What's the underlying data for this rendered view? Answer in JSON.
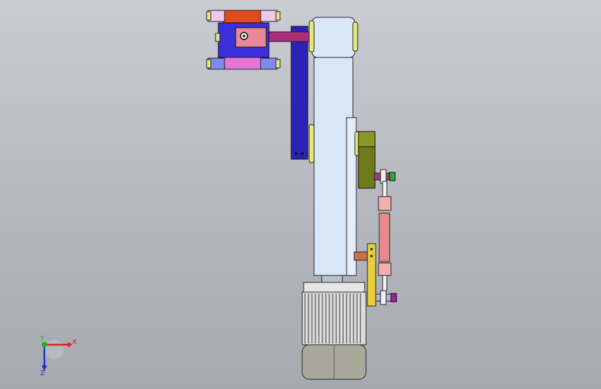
{
  "viewport": {
    "background": "#b8bcc2",
    "view": "front"
  },
  "model": {
    "description_parts": [
      "gearbox-housing",
      "drive-belt",
      "main-column",
      "motor",
      "linkage-rod",
      "bracket",
      "pivot-bolts"
    ],
    "colors": {
      "column": "#d8e6f8",
      "gearbox": "#3a2fd9",
      "housing_top": "#e04a1e",
      "housing_pink": "#e874d8",
      "belt": "#2a23b8",
      "shaft": "#a8307a",
      "bolts": "#e8e87a",
      "bracket_olive": "#6f7a1a",
      "bracket_yellow": "#e8cf3a",
      "rod": "#e88a8a",
      "motor_body": "#d8d8d8",
      "motor_base": "#8f9080"
    }
  },
  "triad": {
    "x_label": "X",
    "y_label": "Y",
    "z_label": "Z",
    "x_color": "#d42020",
    "y_color": "#20b020",
    "z_color": "#2030c8"
  }
}
